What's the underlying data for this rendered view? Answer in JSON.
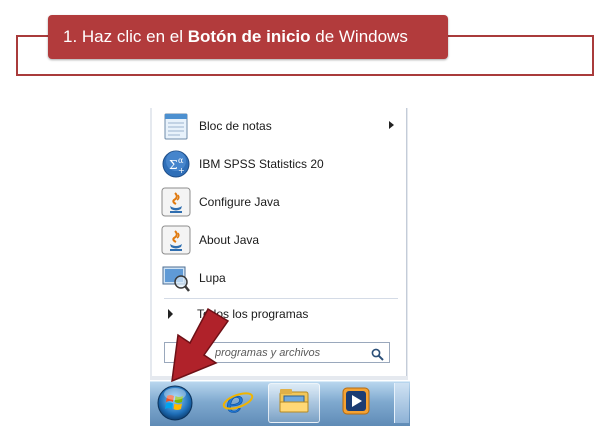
{
  "instruction": {
    "prefix": "1. Haz clic en el ",
    "bold": "Botón de inicio",
    "suffix": " de Windows"
  },
  "start_menu": {
    "items": [
      {
        "label": "Bloc de notas",
        "icon": "notepad-icon",
        "has_submenu": true
      },
      {
        "label": "IBM SPSS Statistics 20",
        "icon": "spss-icon",
        "has_submenu": false
      },
      {
        "label": "Configure Java",
        "icon": "java-icon",
        "has_submenu": false
      },
      {
        "label": "About Java",
        "icon": "java-icon",
        "has_submenu": false
      },
      {
        "label": "Lupa",
        "icon": "magnifier-app-icon",
        "has_submenu": false
      }
    ],
    "all_programs": "Todos los programas",
    "search_placeholder": "programas y archivos"
  },
  "taskbar": {
    "buttons": [
      "start-orb",
      "internet-explorer-icon",
      "windows-explorer-icon",
      "media-player-icon"
    ]
  },
  "colors": {
    "banner": "#b23b3c",
    "arrow": "#b0222a",
    "taskbar": "#7fa9cf"
  }
}
